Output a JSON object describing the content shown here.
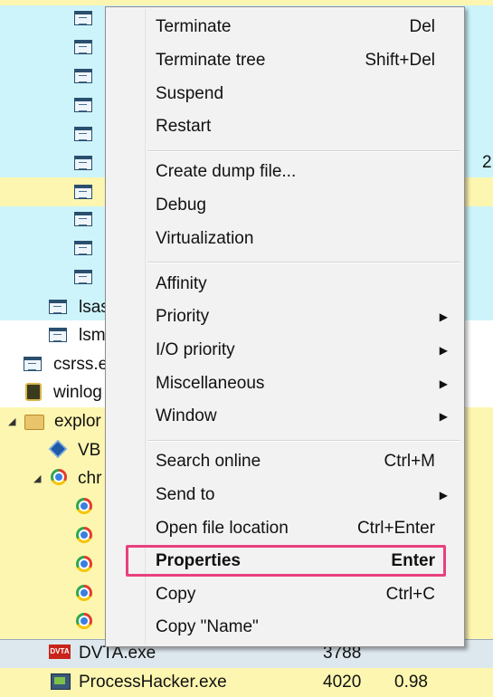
{
  "process_list": {
    "partial_value_right": "2",
    "rows": [
      {
        "name": "lsas",
        "pid": "",
        "cpu": ""
      },
      {
        "name": "lsm",
        "pid": "",
        "cpu": ""
      },
      {
        "name": "csrss.e",
        "pid": "",
        "cpu": ""
      },
      {
        "name": "winlog",
        "pid": "",
        "cpu": ""
      },
      {
        "name": "explor",
        "pid": "",
        "cpu": ""
      },
      {
        "name": "VB",
        "pid": "",
        "cpu": ""
      },
      {
        "name": "chr",
        "pid": "",
        "cpu": ""
      },
      {
        "name": "DVTA.exe",
        "pid": "3788",
        "cpu": ""
      },
      {
        "name": "ProcessHacker.exe",
        "pid": "4020",
        "cpu": "0.98"
      }
    ],
    "dvta_icon_text": "DVTA",
    "colors": {
      "service_bg": "#cdf4fb",
      "own_bg": "#fdf6b0",
      "selected_bg": "#dde8ee",
      "highlight": "#e8407f"
    }
  },
  "context_menu": {
    "groups": [
      [
        {
          "label": "Terminate",
          "shortcut": "Del"
        },
        {
          "label": "Terminate tree",
          "shortcut": "Shift+Del"
        },
        {
          "label": "Suspend",
          "shortcut": ""
        },
        {
          "label": "Restart",
          "shortcut": ""
        }
      ],
      [
        {
          "label": "Create dump file...",
          "shortcut": ""
        },
        {
          "label": "Debug",
          "shortcut": ""
        },
        {
          "label": "Virtualization",
          "shortcut": ""
        }
      ],
      [
        {
          "label": "Affinity",
          "shortcut": ""
        },
        {
          "label": "Priority",
          "shortcut": "",
          "submenu": true
        },
        {
          "label": "I/O priority",
          "shortcut": "",
          "submenu": true
        },
        {
          "label": "Miscellaneous",
          "shortcut": "",
          "submenu": true
        },
        {
          "label": "Window",
          "shortcut": "",
          "submenu": true
        }
      ],
      [
        {
          "label": "Search online",
          "shortcut": "Ctrl+M"
        },
        {
          "label": "Send to",
          "shortcut": "",
          "submenu": true
        },
        {
          "label": "Open file location",
          "shortcut": "Ctrl+Enter"
        },
        {
          "label": "Properties",
          "shortcut": "Enter",
          "bold": true,
          "highlighted": true
        },
        {
          "label": "Copy",
          "shortcut": "Ctrl+C"
        },
        {
          "label": "Copy \"Name\"",
          "shortcut": ""
        }
      ]
    ]
  }
}
